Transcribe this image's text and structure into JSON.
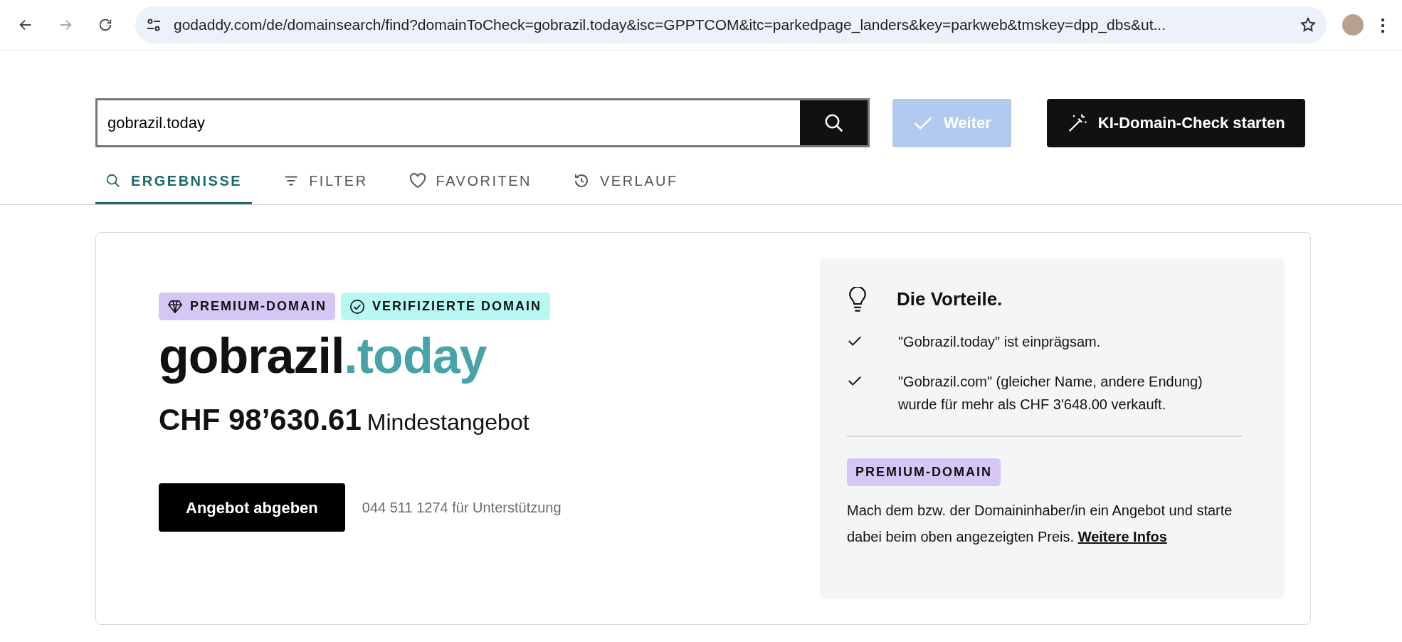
{
  "browser": {
    "url": "godaddy.com/de/domainsearch/find?domainToCheck=gobrazil.today&isc=GPPTCOM&itc=parkedpage_landers&key=parkweb&tmskey=dpp_dbs&ut..."
  },
  "search": {
    "value": "gobrazil.today"
  },
  "actions": [
    {
      "label": "Weiter",
      "kind": "continue",
      "disabled": true
    },
    {
      "label": "KI-Domain-Check starten",
      "kind": "ai",
      "disabled": false
    }
  ],
  "tabs": [
    {
      "label": "ERGEBNISSE",
      "kind": "search",
      "selected": true
    },
    {
      "label": "FILTER",
      "kind": "filter",
      "selected": false
    },
    {
      "label": "FAVORITEN",
      "kind": "heart",
      "selected": false
    },
    {
      "label": "VERLAUF",
      "kind": "history",
      "selected": false
    }
  ],
  "result": {
    "badges": [
      {
        "label": "PREMIUM-DOMAIN",
        "kind": "diamond",
        "color": "#d4c6f5"
      },
      {
        "label": "VERIFIZIERTE DOMAIN",
        "kind": "check",
        "color": "#b8f8f2"
      }
    ],
    "domain": {
      "name": "gobrazil",
      "tld": ".today"
    },
    "price": "CHF 98’630.61",
    "price_note": "Mindestangebot",
    "button": "Angebot abgeben",
    "support": "044 511 1274 für Unterstützung"
  },
  "benefits": {
    "title": "Die Vorteile.",
    "items": [
      "\"Gobrazil.today\" ist einprägsam.",
      "\"Gobrazil.com\" (gleicher Name, andere Endung) wurde für mehr als CHF 3'648.00 verkauft."
    ],
    "badge": {
      "label": "PREMIUM-DOMAIN",
      "color": "#d4c6f5"
    },
    "text": "Mach dem bzw. der Domaininhaber/in ein Angebot und starte dabei beim oben angezeigten Preis.",
    "link": "Weitere Infos"
  }
}
